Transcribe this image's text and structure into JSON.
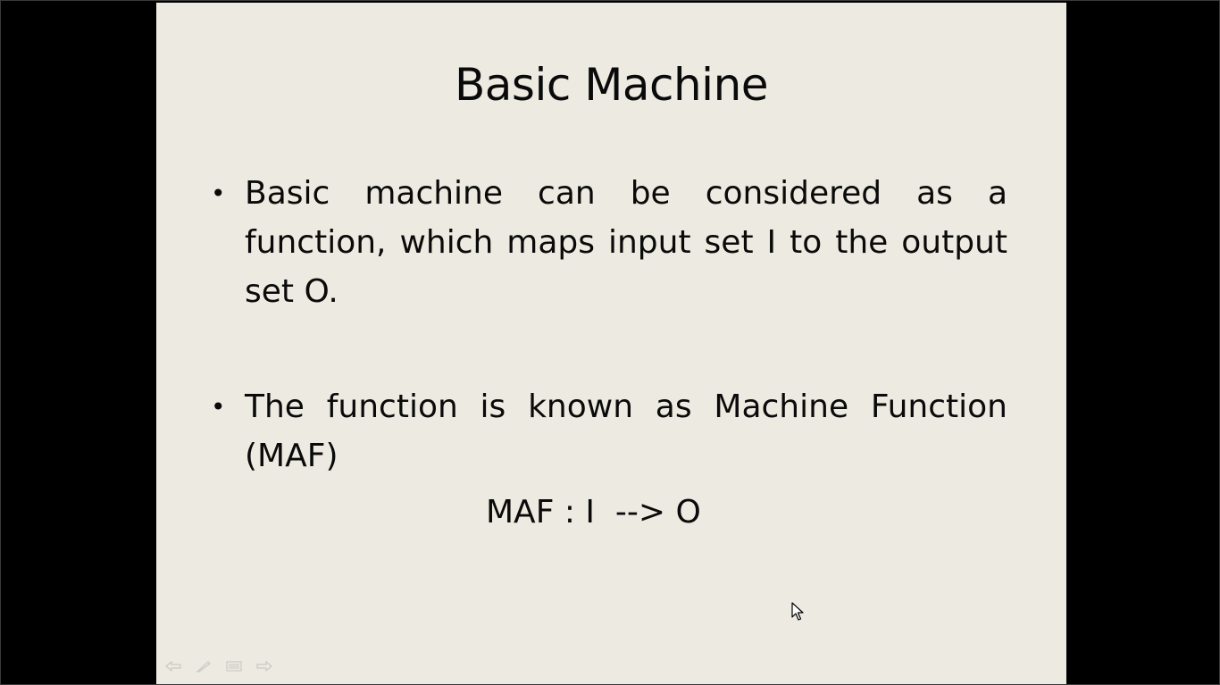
{
  "slide": {
    "title": "Basic Machine",
    "bullets": [
      {
        "text": "Basic machine can be considered as a function, which maps input set I to the output set O."
      },
      {
        "text": "The function is known as Machine Function (MAF)"
      }
    ],
    "formula": "MAF : I  --> O"
  },
  "controls": {
    "icons": [
      "back-arrow-icon",
      "pen-icon",
      "menu-icon",
      "forward-arrow-icon"
    ]
  },
  "colors": {
    "slide_background": "#edebe1",
    "frame": "#000000",
    "text": "#0a0a0a"
  }
}
